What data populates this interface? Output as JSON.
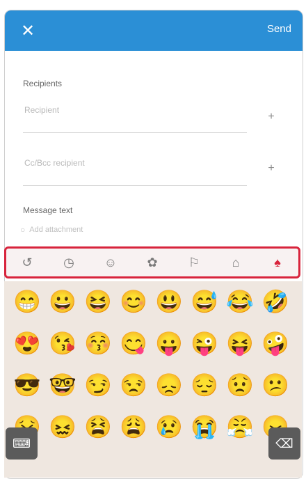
{
  "header": {
    "close_icon_glyph": "✕",
    "send_label": "Send",
    "accent": "#2b8fd6"
  },
  "form": {
    "recipients_label": "Recipients",
    "to_placeholder": "Recipient",
    "cc_placeholder": "Cc/Bcc recipient",
    "plus_glyph": "+",
    "message_label": "Message text",
    "message_hint": "Add attachment"
  },
  "emoji_tabs": {
    "tabs": [
      {
        "name": "tab-recent",
        "glyph": "↺"
      },
      {
        "name": "tab-clock",
        "glyph": "◷"
      },
      {
        "name": "tab-smileys",
        "glyph": "☺"
      },
      {
        "name": "tab-animals",
        "glyph": "✿"
      },
      {
        "name": "tab-objects",
        "glyph": "⚐"
      },
      {
        "name": "tab-places",
        "glyph": "⌂"
      },
      {
        "name": "tab-symbols",
        "glyph": "♠"
      }
    ],
    "highlight_color": "#d8243c"
  },
  "emoji_grid": {
    "items": [
      "😁",
      "😀",
      "😆",
      "😊",
      "😃",
      "😅",
      "😂",
      "🤣",
      "😍",
      "😘",
      "😚",
      "😋",
      "😛",
      "😜",
      "😝",
      "🤪",
      "😎",
      "🤓",
      "😏",
      "😒",
      "😞",
      "😔",
      "😟",
      "😕",
      "😣",
      "😖",
      "😫",
      "😩",
      "😢",
      "😭",
      "😤",
      "😠"
    ]
  },
  "keyboard": {
    "kbd_glyph": "⌨",
    "delete_glyph": "⌫"
  }
}
